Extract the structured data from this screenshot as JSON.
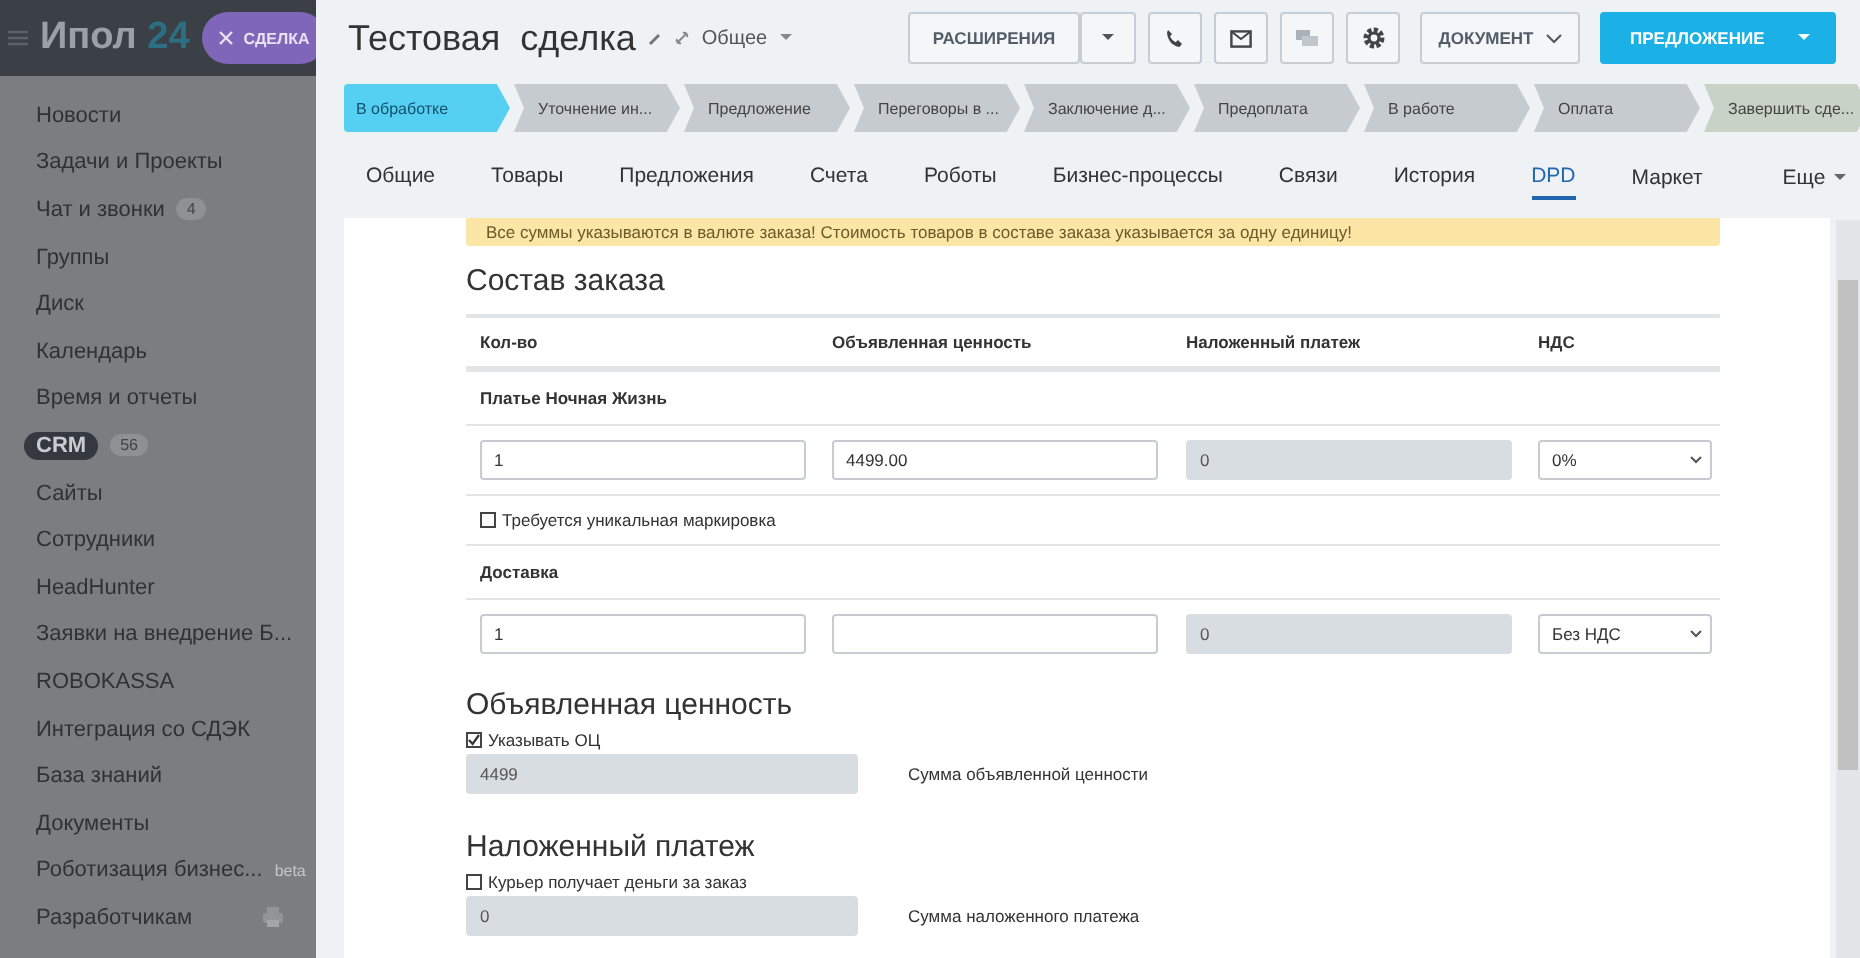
{
  "sidebar": {
    "logo_main": "Ипол",
    "logo_num": "24",
    "deal_chip": "СДЕЛКА",
    "items": [
      {
        "label": "Новости",
        "selected": false
      },
      {
        "label": "Задачи и Проекты",
        "selected": false
      },
      {
        "label": "Чат и звонки",
        "counter": "4",
        "selected": false
      },
      {
        "label": "Группы",
        "selected": false
      },
      {
        "label": "Диск",
        "selected": false
      },
      {
        "label": "Календарь",
        "selected": false
      },
      {
        "label": "Время и отчеты",
        "selected": false
      },
      {
        "label": "CRM",
        "counter": "56",
        "selected": true
      },
      {
        "label": "Сайты",
        "selected": false
      },
      {
        "label": "Сотрудники",
        "selected": false
      },
      {
        "label": "HeadHunter",
        "selected": false
      },
      {
        "label": "Заявки на внедрение Б...",
        "selected": false
      },
      {
        "label": "ROBOKASSA",
        "selected": false
      },
      {
        "label": "Интеграция со СДЭК",
        "selected": false
      },
      {
        "label": "База знаний",
        "selected": false
      },
      {
        "label": "Документы",
        "selected": false
      },
      {
        "label": "Роботизация бизнес...",
        "badge": "beta",
        "selected": false
      },
      {
        "label": "Разработчикам",
        "selected": false
      }
    ]
  },
  "header": {
    "title": "Тестовая  сделка",
    "category": "Общее",
    "extensions_button": "РАСШИРЕНИЯ",
    "document_button": "ДОКУМЕНТ",
    "offer_button": "ПРЕДЛОЖЕНИЕ"
  },
  "stages": [
    {
      "label": "В обработке",
      "kind": "stage",
      "selected": true
    },
    {
      "label": "Уточнение ин...",
      "kind": "stage",
      "selected": false
    },
    {
      "label": "Предложение",
      "kind": "stage",
      "selected": false
    },
    {
      "label": "Переговоры в ...",
      "kind": "stage",
      "selected": false
    },
    {
      "label": "Заключение д...",
      "kind": "stage",
      "selected": false
    },
    {
      "label": "Предоплата",
      "kind": "stage",
      "selected": false
    },
    {
      "label": "В работе",
      "kind": "stage",
      "selected": false
    },
    {
      "label": "Оплата",
      "kind": "stage",
      "selected": false
    },
    {
      "label": "Завершить сде...",
      "kind": "final",
      "selected": false
    }
  ],
  "tabs": [
    {
      "label": "Общие",
      "selected": false
    },
    {
      "label": "Товары",
      "selected": false
    },
    {
      "label": "Предложения",
      "selected": false
    },
    {
      "label": "Счета",
      "selected": false
    },
    {
      "label": "Роботы",
      "selected": false
    },
    {
      "label": "Бизнес-процессы",
      "selected": false
    },
    {
      "label": "Связи",
      "selected": false
    },
    {
      "label": "История",
      "selected": false
    },
    {
      "label": "DPD",
      "selected": true
    }
  ],
  "tabs_right": [
    {
      "label": "Маркет",
      "kind": "plain"
    },
    {
      "label": "Еще",
      "kind": "menu"
    }
  ],
  "form": {
    "notice": "Все суммы указываются в валюте заказа! Стоимость товаров в составе заказа указывается за одну единицу!",
    "order_title": "Состав заказа",
    "columns": [
      "Кол-во",
      "Объявленная ценность",
      "Наложенный платеж",
      "НДС"
    ],
    "items": [
      {
        "name": "Платье Ночная Жизнь",
        "qty": "1",
        "declared": "4499.00",
        "cod": "0",
        "vat": "0%",
        "marking": {
          "label": "Требуется уникальная маркировка",
          "checked": false
        }
      },
      {
        "name": "Доставка",
        "qty": "1",
        "cod": "0",
        "vat": "Без НДС"
      }
    ],
    "sections": [
      {
        "title": "Объявленная ценность",
        "checkbox": {
          "label": "Указывать ОЦ",
          "checked": true
        },
        "value": "4499",
        "caption": "Сумма объявленной ценности"
      },
      {
        "title": "Наложенный платеж",
        "checkbox": {
          "label": "Курьер получает деньги за заказ",
          "checked": false
        },
        "value": "0",
        "caption": "Сумма наложенного платежа"
      }
    ]
  }
}
